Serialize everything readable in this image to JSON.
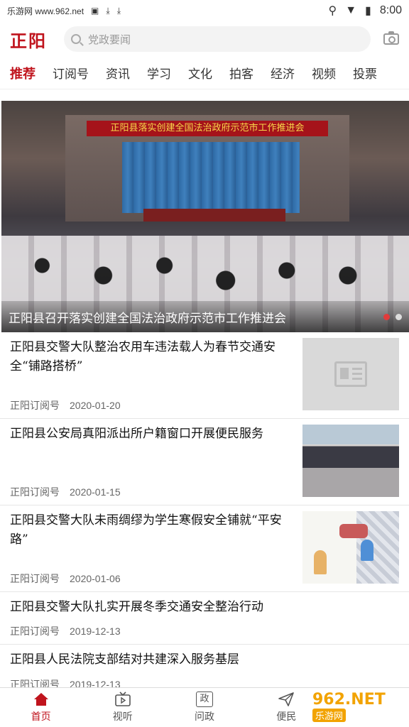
{
  "status_bar": {
    "site_label": "乐游网 www.962.net",
    "time": "8:00"
  },
  "header": {
    "logo_text": "正阳",
    "search_placeholder": "党政要闻"
  },
  "tabs": [
    {
      "label": "推荐",
      "active": true
    },
    {
      "label": "订阅号",
      "active": false
    },
    {
      "label": "资讯",
      "active": false
    },
    {
      "label": "学习",
      "active": false
    },
    {
      "label": "文化",
      "active": false
    },
    {
      "label": "拍客",
      "active": false
    },
    {
      "label": "经济",
      "active": false
    },
    {
      "label": "视频",
      "active": false
    },
    {
      "label": "投票",
      "active": false
    }
  ],
  "banner": {
    "stage_banner_text": "正阳县落实创建全国法治政府示范市工作推进会",
    "caption": "正阳县召开落实创建全国法治政府示范市工作推进会",
    "dots_total": 2,
    "dots_active_index": 0
  },
  "news": [
    {
      "title": "正阳县交警大队整治农用车违法载人为春节交通安全“铺路搭桥”",
      "source": "正阳订阅号",
      "date": "2020-01-20",
      "thumb": "placeholder"
    },
    {
      "title": "正阳县公安局真阳派出所户籍窗口开展便民服务",
      "source": "正阳订阅号",
      "date": "2020-01-15",
      "thumb": "photo"
    },
    {
      "title": "正阳县交警大队未雨绸缪为学生寒假安全铺就“平安路”",
      "source": "正阳订阅号",
      "date": "2020-01-06",
      "thumb": "cartoon"
    },
    {
      "title": "正阳县交警大队扎实开展冬季交通安全整治行动",
      "source": "正阳订阅号",
      "date": "2019-12-13",
      "thumb": null
    },
    {
      "title": "正阳县人民法院支部结对共建深入服务基层",
      "source": "正阳订阅号",
      "date": "2019-12-13",
      "thumb": null
    }
  ],
  "bottom_nav": [
    {
      "label": "首页",
      "icon": "home-icon",
      "active": true
    },
    {
      "label": "视听",
      "icon": "tv-icon",
      "active": false
    },
    {
      "label": "问政",
      "icon": "zheng-icon",
      "glyph": "政",
      "active": false
    },
    {
      "label": "便民",
      "icon": "paper-plane-icon",
      "active": false
    }
  ],
  "watermark": {
    "top": "962.NET",
    "bottom": "乐游网"
  },
  "colors": {
    "brand_red": "#c0141d",
    "dot_active": "#e23b3b"
  }
}
